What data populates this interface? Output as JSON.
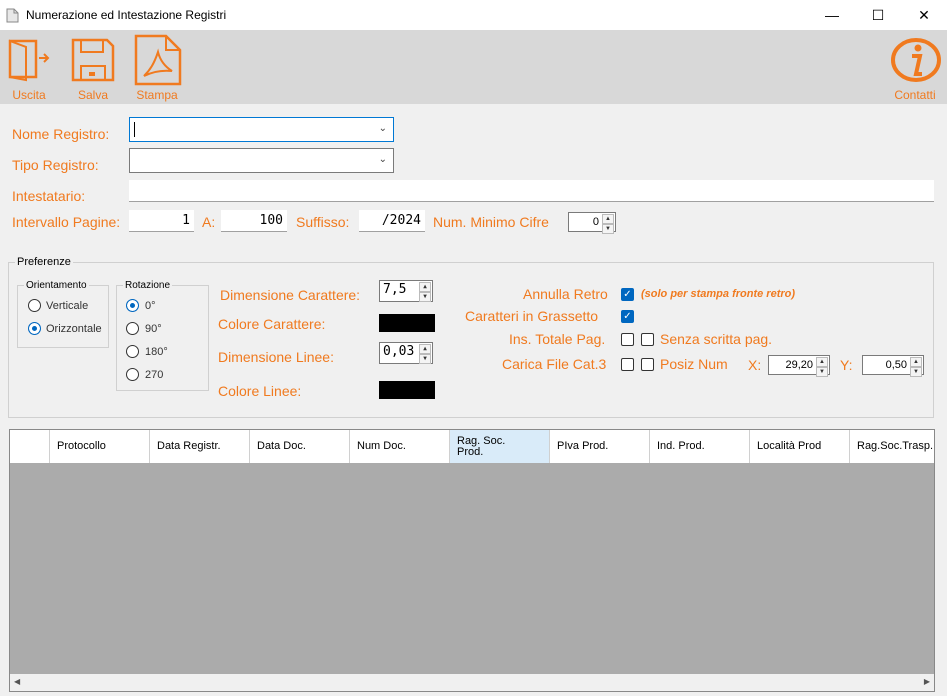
{
  "window": {
    "title": "Numerazione ed Intestazione Registri",
    "minimize": "—",
    "maximize": "☐",
    "close": "✕"
  },
  "toolbar": {
    "exit_label": "Uscita",
    "save_label": "Salva",
    "print_label": "Stampa",
    "contacts_label": "Contatti"
  },
  "form": {
    "nome_registro_label": "Nome Registro:",
    "nome_registro_value": "",
    "tipo_registro_label": "Tipo Registro:",
    "tipo_registro_value": "",
    "intestatario_label": "Intestatario:",
    "intestatario_value": "",
    "intervallo_label": "Intervallo Pagine:",
    "intervallo_from": "1",
    "a_label": "A:",
    "intervallo_to": "100",
    "suffisso_label": "Suffisso:",
    "suffisso_value": "/2024",
    "num_min_cifre_label": "Num. Minimo Cifre",
    "num_min_cifre_value": "0"
  },
  "preferenze": {
    "title": "Preferenze",
    "orientamento": {
      "title": "Orientamento",
      "options": [
        "Verticale",
        "Orizzontale"
      ],
      "selected": "Orizzontale"
    },
    "rotazione": {
      "title": "Rotazione",
      "options": [
        "0°",
        "90°",
        "180°",
        "270"
      ],
      "selected": "0°"
    },
    "dim_carattere_label": "Dimensione Carattere:",
    "dim_carattere_value": "7,5",
    "colore_carattere_label": "Colore Carattere:",
    "colore_carattere": "#000000",
    "dim_linee_label": "Dimensione Linee:",
    "dim_linee_value": "0,03",
    "colore_linee_label": "Colore Linee:",
    "colore_linee": "#000000",
    "annulla_retro_label": "Annulla Retro",
    "annulla_retro_checked": true,
    "annulla_retro_note": "(solo per stampa fronte retro)",
    "grassetto_label": "Caratteri in Grassetto",
    "grassetto_checked": true,
    "ins_totale_label": "Ins. Totale Pag.",
    "ins_totale_checked": false,
    "senza_scritta_label": "Senza scritta pag.",
    "senza_scritta_checked": false,
    "carica_file_label": "Carica File Cat.3",
    "carica_file_checked": false,
    "posiz_num_label": "Posiz Num",
    "posiz_num_checked": false,
    "x_label": "X:",
    "x_value": "29,20",
    "y_label": "Y:",
    "y_value": "0,50"
  },
  "grid": {
    "columns": [
      "Protocollo",
      "Data Registr.",
      "Data Doc.",
      "Num Doc.",
      "Rag. Soc. Prod.",
      "PIva Prod.",
      "Ind. Prod.",
      "Località Prod",
      "Rag.Soc.Trasp."
    ],
    "selected_column": "Rag. Soc. Prod."
  },
  "colors": {
    "accent": "#f07a1f",
    "toolbar_bg": "#d8d8d8",
    "grid_bg": "#ababab",
    "check_blue": "#0067c0"
  }
}
